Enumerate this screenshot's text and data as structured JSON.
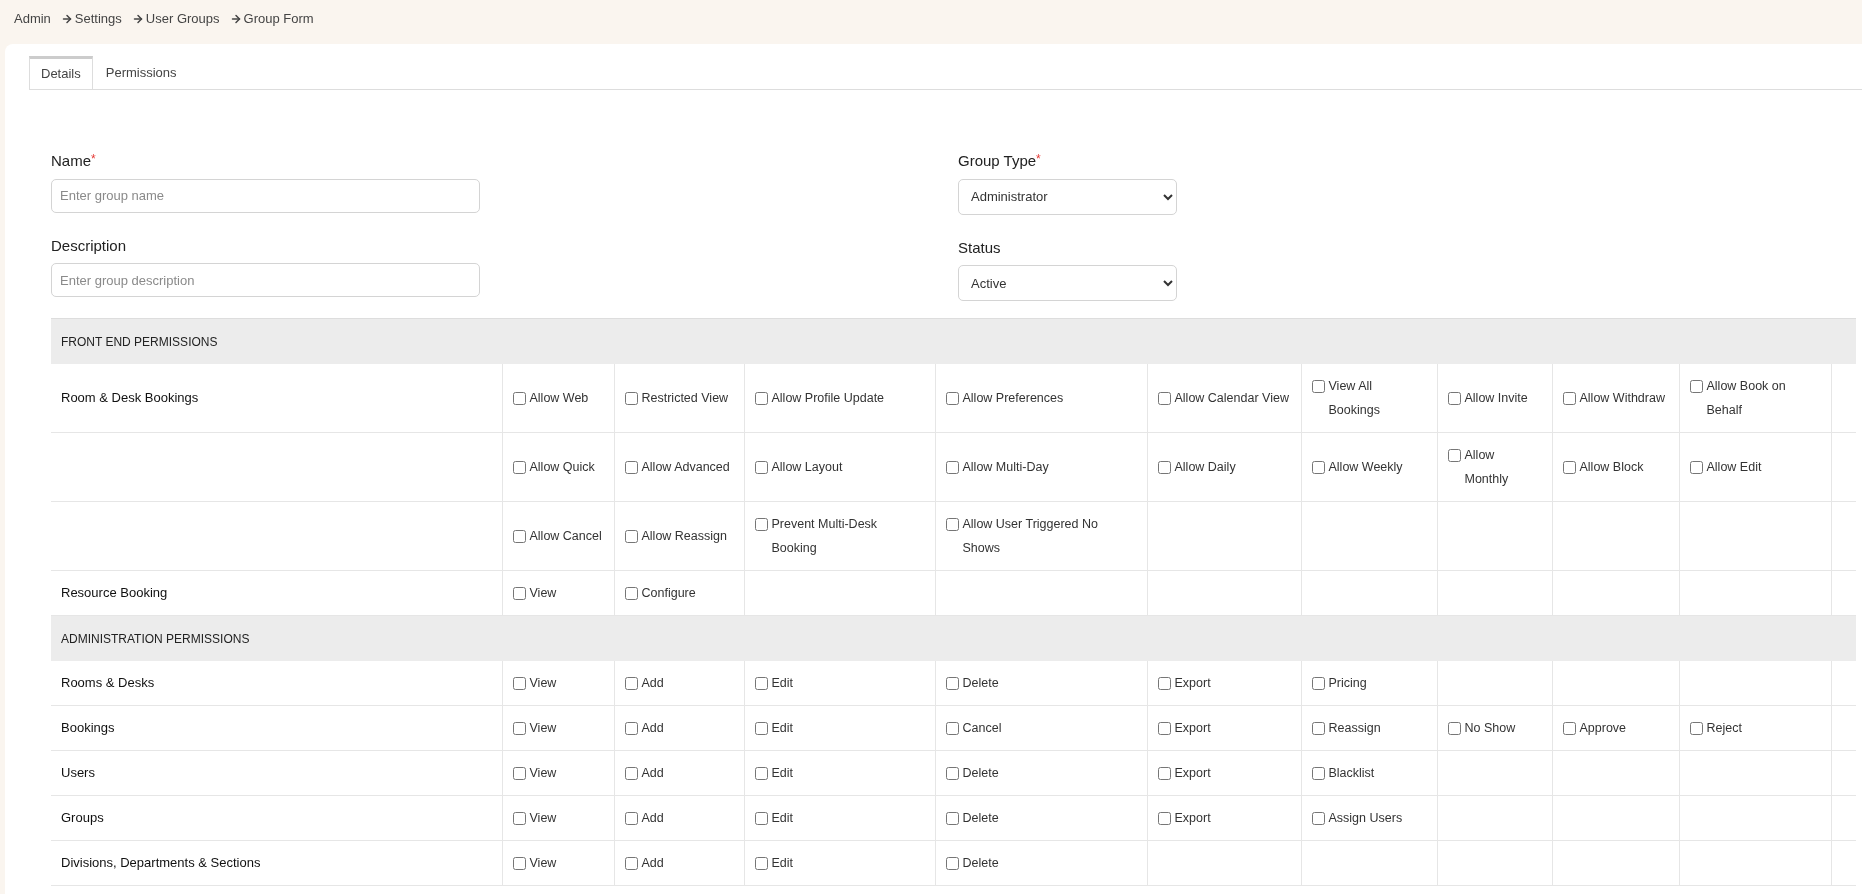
{
  "breadcrumb": [
    {
      "label": "Admin"
    },
    {
      "label": "Settings"
    },
    {
      "label": "User Groups"
    },
    {
      "label": "Group Form"
    }
  ],
  "tabs": [
    {
      "label": "Details",
      "selected": true
    },
    {
      "label": "Permissions",
      "selected": false
    }
  ],
  "form": {
    "required_mark": "*",
    "fields": [
      {
        "label": "Name",
        "required": true,
        "kind": "text",
        "placeholder": "Enter group name"
      },
      {
        "label": "Group Type",
        "required": true,
        "kind": "select",
        "value": "Administrator"
      },
      {
        "label": "Description",
        "required": false,
        "kind": "text",
        "placeholder": "Enter group description"
      },
      {
        "label": "Status",
        "required": false,
        "kind": "select",
        "value": "Active"
      }
    ]
  },
  "permissions": [
    {
      "kind": "section",
      "title": "FRONT END PERMISSIONS"
    },
    {
      "kind": "row",
      "label": "Room & Desk Bookings",
      "options": [
        {
          "label": "Allow Web",
          "checked": false
        },
        {
          "label": "Restricted View",
          "checked": false
        },
        {
          "label": "Allow Profile Update",
          "checked": false
        },
        {
          "label": "Allow Preferences",
          "checked": false
        },
        {
          "label": "Allow Calendar View",
          "checked": false
        },
        {
          "label": "View All Bookings",
          "checked": false
        },
        {
          "label": "Allow Invite",
          "checked": false
        },
        {
          "label": "Allow Withdraw",
          "checked": false
        },
        {
          "label": "Allow Book on Behalf",
          "checked": false
        }
      ]
    },
    {
      "kind": "row",
      "options": [
        {
          "label": "Allow Quick",
          "checked": false
        },
        {
          "label": "Allow Advanced",
          "checked": false
        },
        {
          "label": "Allow Layout",
          "checked": false
        },
        {
          "label": "Allow Multi-Day",
          "checked": false
        },
        {
          "label": "Allow Daily",
          "checked": false
        },
        {
          "label": "Allow Weekly",
          "checked": false
        },
        {
          "label": "Allow Monthly",
          "checked": false
        },
        {
          "label": "Allow Block",
          "checked": false
        },
        {
          "label": "Allow Edit",
          "checked": false
        }
      ]
    },
    {
      "kind": "row",
      "options": [
        {
          "label": "Allow Cancel",
          "checked": false
        },
        {
          "label": "Allow Reassign",
          "checked": false
        },
        {
          "label": "Prevent Multi-Desk Booking",
          "checked": false
        },
        {
          "label": "Allow User Triggered No Shows",
          "checked": false
        }
      ]
    },
    {
      "kind": "row",
      "label": "Resource Booking",
      "options": [
        {
          "label": "View",
          "checked": false
        },
        {
          "label": "Configure",
          "checked": false
        }
      ]
    },
    {
      "kind": "section",
      "title": "ADMINISTRATION PERMISSIONS"
    },
    {
      "kind": "row",
      "label": "Rooms & Desks",
      "options": [
        {
          "label": "View",
          "checked": false
        },
        {
          "label": "Add",
          "checked": false
        },
        {
          "label": "Edit",
          "checked": false
        },
        {
          "label": "Delete",
          "checked": false
        },
        {
          "label": "Export",
          "checked": false
        },
        {
          "label": "Pricing",
          "checked": false
        }
      ]
    },
    {
      "kind": "row",
      "label": "Bookings",
      "options": [
        {
          "label": "View",
          "checked": false
        },
        {
          "label": "Add",
          "checked": false
        },
        {
          "label": "Edit",
          "checked": false
        },
        {
          "label": "Cancel",
          "checked": false
        },
        {
          "label": "Export",
          "checked": false
        },
        {
          "label": "Reassign",
          "checked": false
        },
        {
          "label": "No Show",
          "checked": false
        },
        {
          "label": "Approve",
          "checked": false
        },
        {
          "label": "Reject",
          "checked": false
        }
      ]
    },
    {
      "kind": "row",
      "label": "Users",
      "options": [
        {
          "label": "View",
          "checked": false
        },
        {
          "label": "Add",
          "checked": false
        },
        {
          "label": "Edit",
          "checked": false
        },
        {
          "label": "Delete",
          "checked": false
        },
        {
          "label": "Export",
          "checked": false
        },
        {
          "label": "Blacklist",
          "checked": false
        }
      ]
    },
    {
      "kind": "row",
      "label": "Groups",
      "options": [
        {
          "label": "View",
          "checked": false
        },
        {
          "label": "Add",
          "checked": false
        },
        {
          "label": "Edit",
          "checked": false
        },
        {
          "label": "Delete",
          "checked": false
        },
        {
          "label": "Export",
          "checked": false
        },
        {
          "label": "Assign Users",
          "checked": false
        }
      ]
    },
    {
      "kind": "row",
      "label": "Divisions, Departments & Sections",
      "options": [
        {
          "label": "View",
          "checked": false
        },
        {
          "label": "Add",
          "checked": false
        },
        {
          "label": "Edit",
          "checked": false
        },
        {
          "label": "Delete",
          "checked": false
        }
      ]
    }
  ]
}
